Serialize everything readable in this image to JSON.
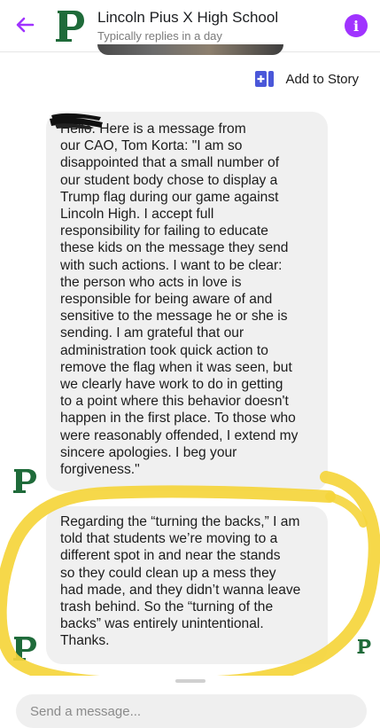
{
  "header": {
    "title": "Lincoln Pius X High School",
    "subtitle": "Typically replies in a day",
    "back_icon": "back-arrow-icon",
    "info_icon": "info-icon",
    "info_glyph": "i",
    "logo_letter": "P"
  },
  "story": {
    "add_label": "Add to Story"
  },
  "messages": [
    {
      "text": "Hello. Here is a message from\nour CAO, Tom Korta: \"I am so\ndisappointed that a small number of\nour student body chose to display a\nTrump flag during our game against\nLincoln High. I accept full\nresponsibility for failing to educate\nthese kids on the message they send\nwith such actions. I want to be clear:\nthe person who acts in love is\nresponsible for being aware of and\nsensitive to the message he or she is\nsending. I am grateful that our\nadministration took quick action to\nremove the flag when it was seen, but\nwe clearly have work to do in getting\nto a point where this behavior doesn't\nhappen in the first place. To those who\nwere reasonably offended, I extend my\nsincere apologies. I beg your\nforgiveness.\""
    },
    {
      "text": "Regarding the “turning the backs,” I am\ntold that students we’re moving to a\ndifferent spot in and near the stands\nso they could clean up a mess they\nhad made, and they didn’t wanna leave\ntrash behind. So the “turning of the\nbacks” was entirely unintentional.\nThanks."
    }
  ],
  "composer": {
    "placeholder": "Send a message..."
  },
  "colors": {
    "accent_purple": "#a033ff",
    "brand_green": "#1f6b3a",
    "highlight_yellow": "#f5d53b"
  }
}
